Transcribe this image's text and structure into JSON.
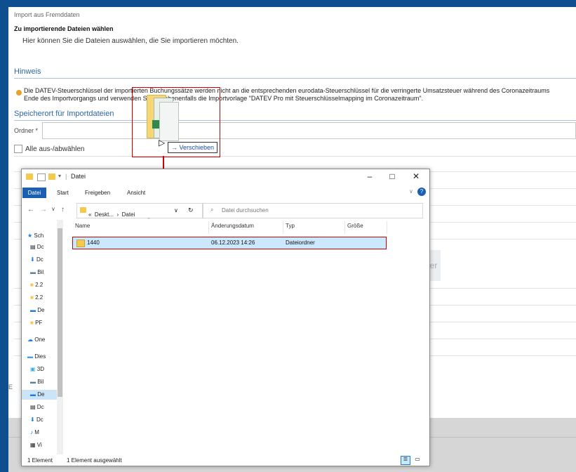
{
  "background": {
    "window_title": "Import aus Fremddaten",
    "heading": "Zu importierende Dateien wählen",
    "subtext": "Hier können Sie die Dateien auswählen, die Sie importieren möchten.",
    "hint_title": "Hinweis",
    "hint_line1": "Die DATEV-Steuerschlüssel der importierten Buchungssätze werden nicht an die entsprechenden eurodata-Steuerschlüssel für die verringerte Umsatzsteuer während des Coronazeitraums",
    "hint_line2": "Ende des Importvorgangs und verwenden Sie gegebenenfalls die Importvorlage \"DATEV Pro mit Steuerschlüsselmapping im Coronazeitraum\".",
    "storage_title": "Speicherort für Importdateien",
    "folder_label": "Ordner *",
    "select_all_label": "Alle aus-/abwählen",
    "side_letter": "E",
    "button_fragment": "er"
  },
  "drag": {
    "tooltip": "Verschieben"
  },
  "explorer": {
    "title": "Datei",
    "ribbon_tabs": [
      "Datei",
      "Start",
      "Freigeben",
      "Ansicht"
    ],
    "address_parts": [
      "«",
      "Deskt...",
      "›",
      "Datei"
    ],
    "search_placeholder": "Datei durchsuchen",
    "columns": [
      "Name",
      "Änderungsdatum",
      "Typ",
      "Größe"
    ],
    "rows": [
      {
        "name": "1440",
        "date": "06.12.2023 14:26",
        "type": "Dateiordner",
        "size": ""
      }
    ],
    "nav_items": [
      "Sch",
      "Dc",
      "Dc",
      "Bil",
      "2.2",
      "2.2",
      "De",
      "PF",
      "One",
      "Dies",
      "3D",
      "Bil",
      "De",
      "Dc",
      "Dc",
      "M",
      "Vi"
    ],
    "status_count": "1 Element",
    "status_selected": "1 Element ausgewählt"
  },
  "colors": {
    "accent": "#1a5fb4",
    "highlight_red": "#d00000",
    "selection": "#cce8ff"
  }
}
